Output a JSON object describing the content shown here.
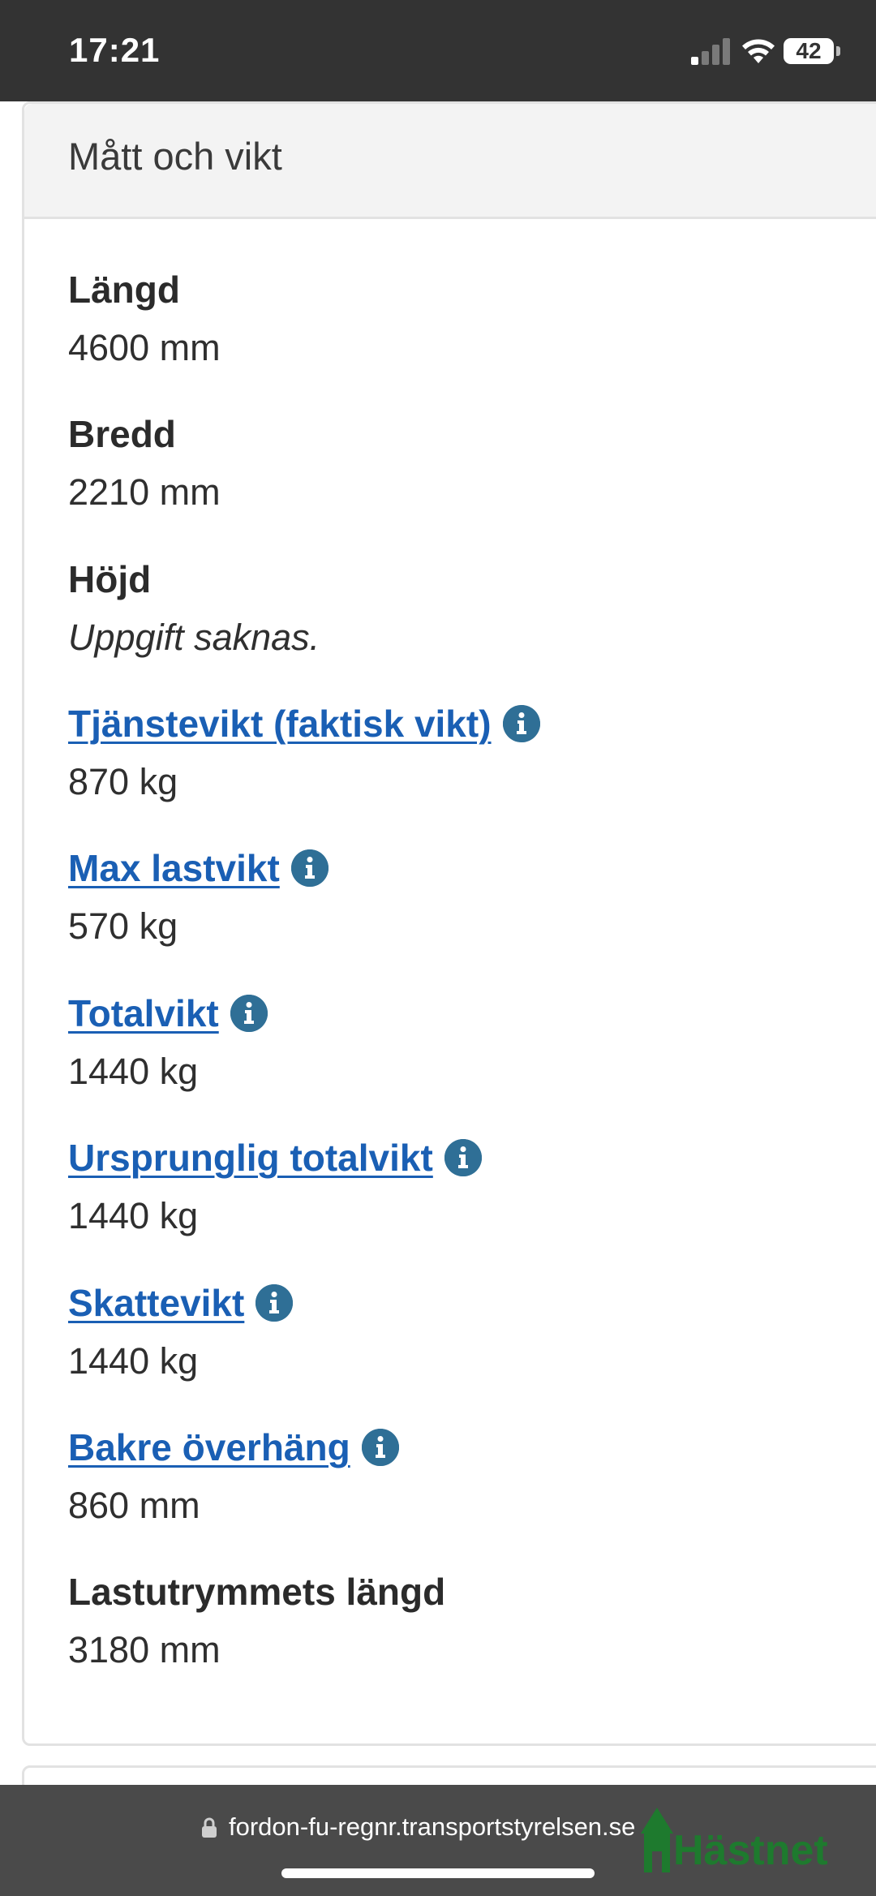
{
  "status_bar": {
    "time": "17:21",
    "battery": "42",
    "icons": [
      "signal-icon",
      "wifi-icon",
      "battery-icon"
    ]
  },
  "section": {
    "title": "Mått och vikt",
    "fields": [
      {
        "label": "Längd",
        "value": "4600 mm",
        "link": false
      },
      {
        "label": "Bredd",
        "value": "2210 mm",
        "link": false
      },
      {
        "label": "Höjd",
        "value": "Uppgift saknas.",
        "link": false,
        "italic": true
      },
      {
        "label": "Tjänstevikt (faktisk vikt)",
        "value": "870 kg",
        "link": true
      },
      {
        "label": "Max lastvikt",
        "value": "570 kg",
        "link": true
      },
      {
        "label": "Totalvikt",
        "value": "1440 kg",
        "link": true
      },
      {
        "label": "Ursprunglig totalvikt",
        "value": "1440 kg",
        "link": true
      },
      {
        "label": "Skattevikt",
        "value": "1440 kg",
        "link": true
      },
      {
        "label": "Bakre överhäng",
        "value": "860 mm",
        "link": true
      },
      {
        "label": "Lastutrymmets längd",
        "value": "3180 mm",
        "link": false
      }
    ]
  },
  "browser": {
    "url": "fordon-fu-regnr.transportstyrelsen.se"
  },
  "watermark": {
    "text": "Hästnet"
  },
  "colors": {
    "link": "#1a5fb4",
    "info_icon": "#2f6f96",
    "status_bar": "#333333",
    "bottom_bar": "#4a4a4a",
    "watermark": "#1e7a2e"
  }
}
